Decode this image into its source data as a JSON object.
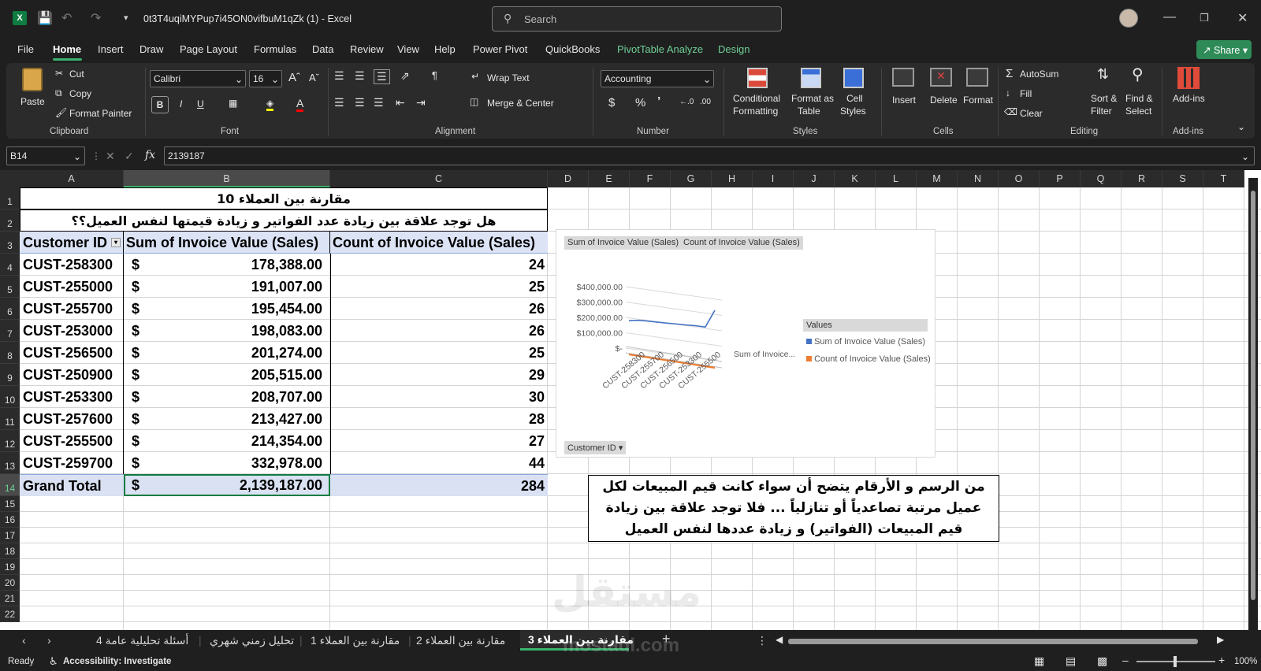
{
  "titlebar": {
    "filename": "0t3T4uqiMYPup7i45ON0vifbuM1qZk (1)",
    "sep": "-",
    "app": "Excel",
    "search_placeholder": "Search"
  },
  "menu": {
    "items": [
      "File",
      "Home",
      "Insert",
      "Draw",
      "Page Layout",
      "Formulas",
      "Data",
      "Review",
      "View",
      "Help",
      "Power Pivot",
      "QuickBooks",
      "PivotTable Analyze",
      "Design"
    ],
    "share": "Share"
  },
  "ribbon": {
    "clipboard": {
      "paste": "Paste",
      "cut": "Cut",
      "copy": "Copy",
      "format_painter": "Format Painter",
      "label": "Clipboard"
    },
    "font": {
      "name": "Calibri",
      "size": "16",
      "label": "Font"
    },
    "alignment": {
      "wrap": "Wrap Text",
      "merge": "Merge & Center",
      "label": "Alignment"
    },
    "number": {
      "format": "Accounting",
      "label": "Number"
    },
    "styles": {
      "cond1": "Conditional",
      "cond2": "Formatting",
      "fat1": "Format as",
      "fat2": "Table",
      "cs1": "Cell",
      "cs2": "Styles",
      "label": "Styles"
    },
    "cells": {
      "insert": "Insert",
      "delete": "Delete",
      "format": "Format",
      "label": "Cells"
    },
    "editing": {
      "autosum": "AutoSum",
      "fill": "Fill",
      "clear": "Clear",
      "sort1": "Sort &",
      "sort2": "Filter",
      "find1": "Find &",
      "find2": "Select",
      "label": "Editing"
    },
    "addins": {
      "btn": "Add-ins",
      "label": "Add-ins"
    }
  },
  "formula_bar": {
    "namebox": "B14",
    "fx": "fx",
    "value": "2139187"
  },
  "columns": [
    "A",
    "B",
    "C",
    "D",
    "E",
    "F",
    "G",
    "H",
    "I",
    "J",
    "K",
    "L",
    "M",
    "N",
    "O",
    "P",
    "Q",
    "R",
    "S",
    "T"
  ],
  "rows": [
    "1",
    "2",
    "3",
    "4",
    "5",
    "6",
    "7",
    "8",
    "9",
    "10",
    "11",
    "12",
    "13",
    "14",
    "15",
    "16",
    "17",
    "18",
    "19",
    "20",
    "21",
    "22"
  ],
  "sheet": {
    "title": "مقارنة بين العملاء 10",
    "question": "هل توجد علاقة بين زيادة عدد الفواتير و زيادة قيمتها لنفس العميل؟؟",
    "headers": [
      "Customer ID",
      "Sum of Invoice Value (Sales)",
      "Count of Invoice Value (Sales)"
    ],
    "data": [
      [
        "CUST-258300",
        "$",
        "178,388.00",
        "24"
      ],
      [
        "CUST-255000",
        "$",
        "191,007.00",
        "25"
      ],
      [
        "CUST-255700",
        "$",
        "195,454.00",
        "26"
      ],
      [
        "CUST-253000",
        "$",
        "198,083.00",
        "26"
      ],
      [
        "CUST-256500",
        "$",
        "201,274.00",
        "25"
      ],
      [
        "CUST-250900",
        "$",
        "205,515.00",
        "29"
      ],
      [
        "CUST-253300",
        "$",
        "208,707.00",
        "30"
      ],
      [
        "CUST-257600",
        "$",
        "213,427.00",
        "28"
      ],
      [
        "CUST-255500",
        "$",
        "214,354.00",
        "27"
      ],
      [
        "CUST-259700",
        "$",
        "332,978.00",
        "44"
      ]
    ],
    "total": [
      "Grand Total",
      "$",
      "2,139,187.00",
      "284"
    ],
    "note": "من الرسم و الأرقام يتضح أن سواء كانت قيم المبيعات لكل عميل مرتبة تصاعدياً أو تنازلياً ... فلا توجد علاقة بين زيادة قيم المبيعات (الفواتير) و زيادة عددها لنفس العميل"
  },
  "chart": {
    "field_buttons": [
      "Sum of Invoice Value (Sales)",
      "Count of Invoice Value (Sales)"
    ],
    "y_ticks": [
      "$400,000.00",
      "$300,000.00",
      "$200,000.00",
      "$100,000.00",
      "$-"
    ],
    "x_ticks": [
      "CUST-258300",
      "CUST-255700",
      "CUST-256500",
      "CUST-253300",
      "CUST-255500"
    ],
    "depth_label": "Sum of Invoice...",
    "legend_title": "Values",
    "legend": [
      "Sum of Invoice Value (Sales)",
      "Count of Invoice Value (Sales)"
    ],
    "axis_button": "Customer ID",
    "colors": {
      "sum": "#4472C4",
      "count": "#ED7D31"
    }
  },
  "chart_data": {
    "type": "line",
    "categories": [
      "CUST-258300",
      "CUST-255000",
      "CUST-255700",
      "CUST-253000",
      "CUST-256500",
      "CUST-250900",
      "CUST-253300",
      "CUST-257600",
      "CUST-255500",
      "CUST-259700"
    ],
    "series": [
      {
        "name": "Sum of Invoice Value (Sales)",
        "values": [
          178388,
          191007,
          195454,
          198083,
          201274,
          205515,
          208707,
          213427,
          214354,
          332978
        ]
      },
      {
        "name": "Count of Invoice Value (Sales)",
        "values": [
          24,
          25,
          26,
          26,
          25,
          29,
          30,
          28,
          27,
          44
        ]
      }
    ],
    "ylim": [
      0,
      400000
    ],
    "legend": "right"
  },
  "tabs": [
    "أسئلة تحليلية عامة 4",
    "تحليل زمني شهري",
    "مقارنة بين العملاء 1",
    "مقارنة بين العملاء 2",
    "مقارنة بين العملاء 3"
  ],
  "status": {
    "ready": "Ready",
    "accessibility": "Accessibility: Investigate",
    "zoom": "100%"
  },
  "watermark": {
    "text1": "مستقل",
    "text2": "mostaql.com"
  }
}
